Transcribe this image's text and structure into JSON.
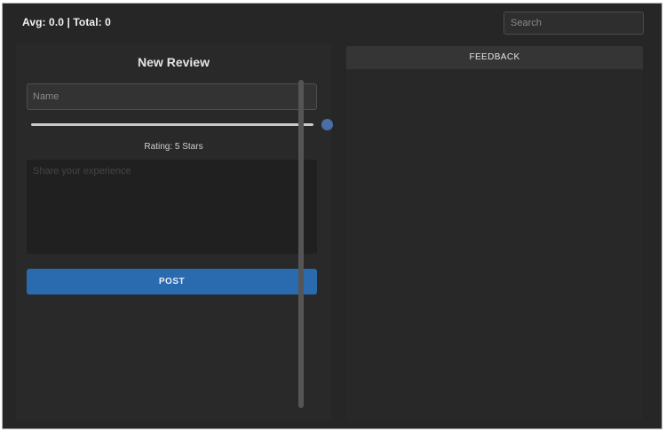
{
  "header": {
    "stats_text": "Avg: 0.0 | Total: 0",
    "search_placeholder": "Search"
  },
  "review_form": {
    "title": "New Review",
    "name_placeholder": "Name",
    "rating_value": 5,
    "rating_max": 5,
    "rating_label": "Rating: 5 Stars",
    "text_placeholder": "Share your experience",
    "post_label": "POST"
  },
  "feedback": {
    "header_label": "FEEDBACK",
    "items": []
  },
  "colors": {
    "background": "#262626",
    "accent": "#2a6bb0",
    "slider_thumb": "#4a6fa8"
  }
}
